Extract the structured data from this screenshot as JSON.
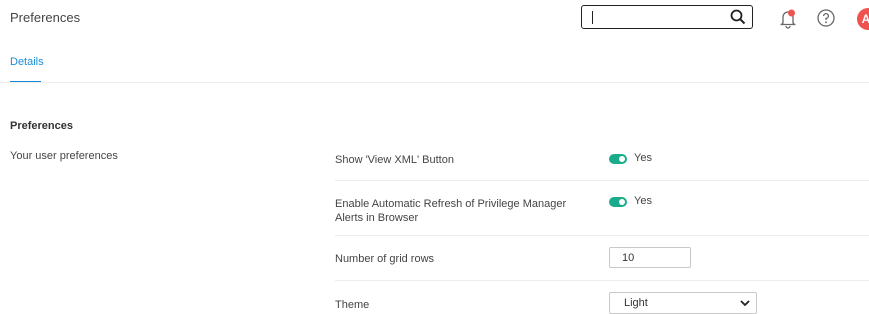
{
  "header": {
    "title": "Preferences",
    "search_value": "",
    "icons": [
      "search-icon",
      "bell-icon",
      "help-icon"
    ],
    "notification_dot_color": "#f0524f",
    "avatar_initial": "A",
    "avatar_color": "#f0524f"
  },
  "tabs": [
    {
      "label": "Details",
      "active": true
    }
  ],
  "accent_color": "#1a8cd8",
  "toggle_color": "#1aab8b",
  "section": {
    "title": "Preferences",
    "description": "Your user preferences"
  },
  "settings": [
    {
      "label": "Show 'View XML' Button",
      "type": "toggle",
      "value": "Yes",
      "on": true
    },
    {
      "label": "Enable Automatic Refresh of Privilege Manager Alerts in Browser",
      "type": "toggle",
      "value": "Yes",
      "on": true
    },
    {
      "label": "Number of grid rows",
      "type": "number",
      "value": "10"
    },
    {
      "label": "Theme",
      "type": "select",
      "value": "Light"
    }
  ]
}
